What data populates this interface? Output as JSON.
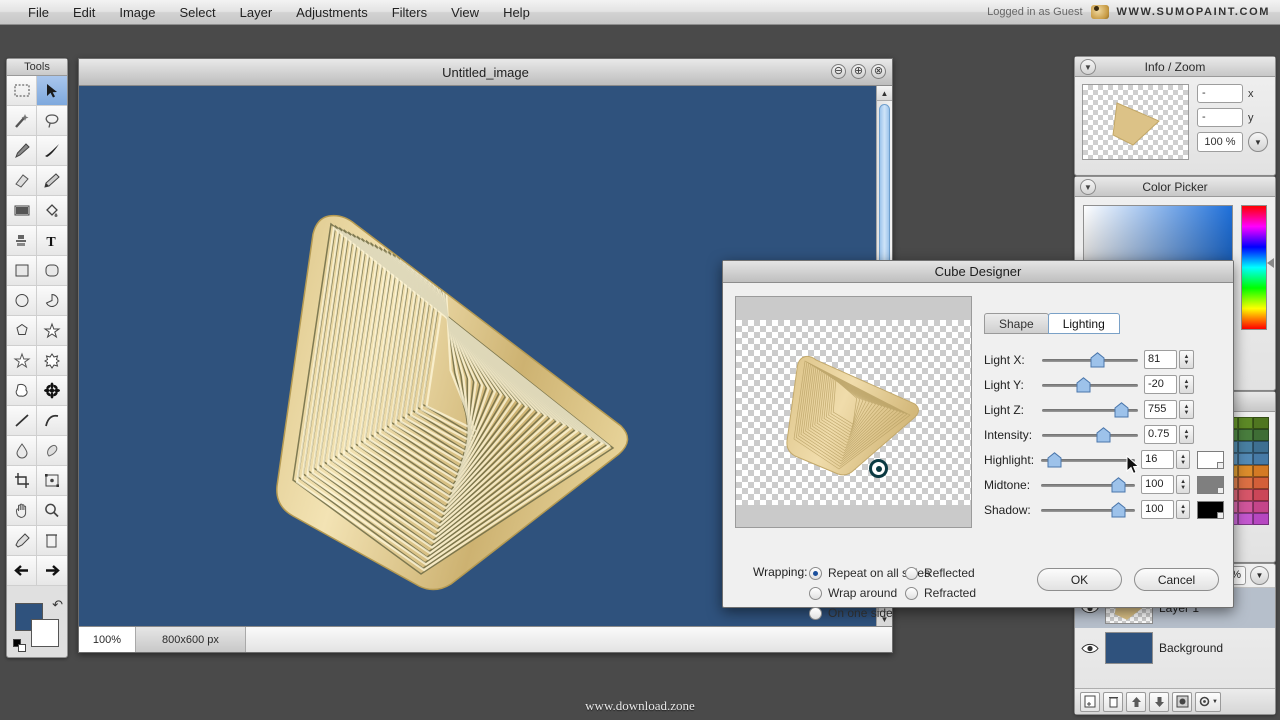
{
  "app": {
    "brand": "WWW.SUMOPAINT.COM",
    "login_status": "Logged in as Guest",
    "watermark": "www.download.zone"
  },
  "menubar": {
    "items": [
      "File",
      "Edit",
      "Image",
      "Select",
      "Layer",
      "Adjustments",
      "Filters",
      "View",
      "Help"
    ]
  },
  "tools": {
    "title": "Tools",
    "items": [
      {
        "name": "rectangular-marquee-tool",
        "selected": false
      },
      {
        "name": "move-tool",
        "selected": true
      },
      {
        "name": "magic-wand-tool",
        "selected": false
      },
      {
        "name": "lasso-tool",
        "selected": false
      },
      {
        "name": "paintbrush-tool",
        "selected": false
      },
      {
        "name": "ink-brush-tool",
        "selected": false
      },
      {
        "name": "eraser-tool",
        "selected": false
      },
      {
        "name": "pencil-tool",
        "selected": false
      },
      {
        "name": "gradient-tool",
        "selected": false
      },
      {
        "name": "paint-bucket-tool",
        "selected": false
      },
      {
        "name": "clone-stamp-tool",
        "selected": false
      },
      {
        "name": "text-tool",
        "selected": false
      },
      {
        "name": "rectangle-shape-tool",
        "selected": false
      },
      {
        "name": "rounded-rectangle-tool",
        "selected": false
      },
      {
        "name": "ellipse-shape-tool",
        "selected": false
      },
      {
        "name": "pie-shape-tool",
        "selected": false
      },
      {
        "name": "polygon-shape-tool",
        "selected": false
      },
      {
        "name": "star-shape-tool",
        "selected": false
      },
      {
        "name": "star-outline-tool",
        "selected": false
      },
      {
        "name": "gear-shape-tool",
        "selected": false
      },
      {
        "name": "blob-shape-tool",
        "selected": false
      },
      {
        "name": "flower-shape-tool",
        "selected": false
      },
      {
        "name": "line-tool",
        "selected": false
      },
      {
        "name": "curve-tool",
        "selected": false
      },
      {
        "name": "blur-tool",
        "selected": false
      },
      {
        "name": "smudge-tool",
        "selected": false
      },
      {
        "name": "crop-tool",
        "selected": false
      },
      {
        "name": "transform-tool",
        "selected": false
      },
      {
        "name": "hand-tool",
        "selected": false
      },
      {
        "name": "zoom-tool",
        "selected": false
      },
      {
        "name": "eyedropper-tool",
        "selected": false
      },
      {
        "name": "delete-tool",
        "selected": false
      },
      {
        "name": "undo-arrow-tool",
        "selected": false
      },
      {
        "name": "redo-arrow-tool",
        "selected": false
      }
    ],
    "foreground_color": "#2f527d",
    "background_color": "#ffffff"
  },
  "canvas_window": {
    "title": "Untitled_image",
    "buttons": [
      {
        "name": "minimize-button",
        "glyph": "⊖"
      },
      {
        "name": "maximize-button",
        "glyph": "⊕"
      },
      {
        "name": "close-button",
        "glyph": "⊗"
      }
    ],
    "background_color": "#2f527d",
    "status": {
      "zoom": "100%",
      "dimensions": "800x600 px"
    }
  },
  "panels": {
    "info_zoom": {
      "title": "Info / Zoom",
      "x_value": "-",
      "x_label": "x",
      "y_value": "-",
      "y_label": "y",
      "zoom_value": "100 %"
    },
    "color_picker": {
      "title": "Color Picker",
      "selected_color": "#2f6fd0"
    },
    "swatches": {
      "colors": [
        "#8a9a3a",
        "#a9c23f",
        "#8fd24a",
        "#a7e05b",
        "#c2ea6e",
        "#d4f07e",
        "#b9d84f",
        "#9cc63f",
        "#7fb235",
        "#6a9c2c",
        "#5d8a26",
        "#4f7620",
        "#7a8f4a",
        "#7f9a57",
        "#6f9d5e",
        "#6fae6a",
        "#84c27c",
        "#9ad18f",
        "#8cc779",
        "#77b566",
        "#63a055",
        "#548e48",
        "#497e3e",
        "#3e6d35",
        "#6a7fa0",
        "#7b8fb5",
        "#6f9ec4",
        "#6fb0cf",
        "#84c3da",
        "#9ad2e4",
        "#8cc9dd",
        "#77b7cf",
        "#63a3c1",
        "#5491b2",
        "#4980a2",
        "#3e6f91",
        "#5b6fbf",
        "#6f84cd",
        "#7fa0d8",
        "#86b6e0",
        "#97c8e8",
        "#abd7ef",
        "#9fcfe8",
        "#8bbfdd",
        "#75add1",
        "#629bc4",
        "#548bb6",
        "#477aa6",
        "#e8802f",
        "#ee9a3c",
        "#f2b14a",
        "#f5c75a",
        "#f7da6c",
        "#f9e87e",
        "#f6e06a",
        "#f2cf55",
        "#ecb943",
        "#e5a236",
        "#dd8d2c",
        "#d47a24",
        "#e06050",
        "#e87560",
        "#ef8c6e",
        "#f4a47e",
        "#f7bb8f",
        "#fad0a1",
        "#f8c68d",
        "#f4b177",
        "#ee9a63",
        "#e68452",
        "#dd7044",
        "#d35f39",
        "#d84f70",
        "#e26480",
        "#ea7a91",
        "#f191a3",
        "#f6a8b5",
        "#fabfc8",
        "#f8b3bd",
        "#f49aa7",
        "#ec8191",
        "#e26a7c",
        "#d75669",
        "#cb4658",
        "#cf4fa8",
        "#da65b4",
        "#e37bc0",
        "#eb92cb",
        "#f2a9d6",
        "#f7c0e1",
        "#f5b4da",
        "#f09bcd",
        "#e882bf",
        "#de6aae",
        "#d2569c",
        "#c4458a",
        "#c04ee0",
        "#ca66e6",
        "#d37deb",
        "#dc94ef",
        "#e4abf3",
        "#ecc2f7",
        "#e8b6f4",
        "#e29eee",
        "#da85e7",
        "#d06cdd",
        "#c458d0",
        "#b647c1"
      ]
    },
    "layers": {
      "opacity": "%",
      "items": [
        {
          "name": "Layer 1",
          "visible": true,
          "selected": true,
          "transparent": true
        },
        {
          "name": "Background",
          "visible": true,
          "selected": false,
          "transparent": false,
          "color": "#2f527d"
        }
      ],
      "buttons": [
        {
          "name": "new-layer-button"
        },
        {
          "name": "delete-layer-button"
        },
        {
          "name": "move-layer-up-button"
        },
        {
          "name": "move-layer-down-button"
        },
        {
          "name": "layer-mask-button"
        },
        {
          "name": "layer-settings-button"
        }
      ]
    }
  },
  "dialog": {
    "title": "Cube Designer",
    "tabs": [
      {
        "label": "Shape",
        "active": false
      },
      {
        "label": "Lighting",
        "active": true
      }
    ],
    "controls": [
      {
        "label": "Light X:",
        "value": "81",
        "slider_pct": 62,
        "has_color": false
      },
      {
        "label": "Light Y:",
        "value": "-20",
        "slider_pct": 44,
        "has_color": false
      },
      {
        "label": "Light Z:",
        "value": "755",
        "slider_pct": 92,
        "has_color": false
      },
      {
        "label": "Intensity:",
        "value": "0.75",
        "slider_pct": 70,
        "has_color": false
      },
      {
        "label": "Highlight:",
        "value": "16",
        "slider_pct": 8,
        "has_color": true,
        "color": "#ffffff"
      },
      {
        "label": "Midtone:",
        "value": "100",
        "slider_pct": 92,
        "has_color": true,
        "color": "#7f7f7f"
      },
      {
        "label": "Shadow:",
        "value": "100",
        "slider_pct": 92,
        "has_color": true,
        "color": "#000000"
      }
    ],
    "tooltip": "16",
    "wrapping": {
      "label": "Wrapping:",
      "options_col1": [
        {
          "label": "Repeat on all sides",
          "selected": true
        },
        {
          "label": "Wrap around",
          "selected": false
        },
        {
          "label": "On one side",
          "selected": false
        }
      ],
      "options_col2": [
        {
          "label": "Reflected",
          "selected": false
        },
        {
          "label": "Refracted",
          "selected": false
        }
      ]
    },
    "ok_label": "OK",
    "cancel_label": "Cancel"
  }
}
